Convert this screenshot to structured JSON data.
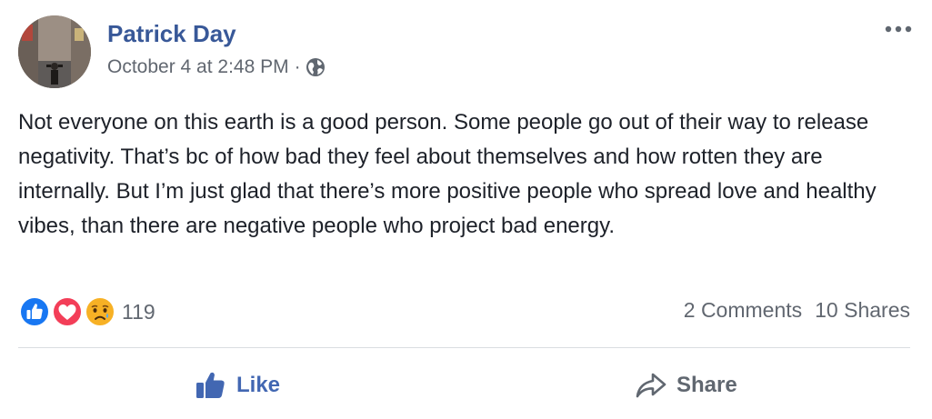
{
  "post": {
    "author": "Patrick Day",
    "timestamp": "October 4 at 2:48 PM",
    "separator": "·",
    "privacy_icon": "globe-icon",
    "more_icon": "more-options-icon",
    "text": "Not everyone on this earth is a good person. Some people go out of their way to release negativity. That’s bc of how bad they feel about themselves and how rotten they are internally. But I’m just glad that there’s more positive people who spread love and healthy vibes, than there are negative people who project bad energy."
  },
  "reactions": {
    "icons": [
      "like-reaction-icon",
      "love-reaction-icon",
      "sad-reaction-icon"
    ],
    "count": "119"
  },
  "stats": {
    "comments": "2 Comments",
    "shares": "10 Shares"
  },
  "actions": {
    "like_label": "Like",
    "share_label": "Share"
  },
  "colors": {
    "author": "#385898",
    "like_accent": "#4267b2",
    "meta_text": "#616770",
    "love": "#f33e58",
    "sad": "#f7b125"
  }
}
